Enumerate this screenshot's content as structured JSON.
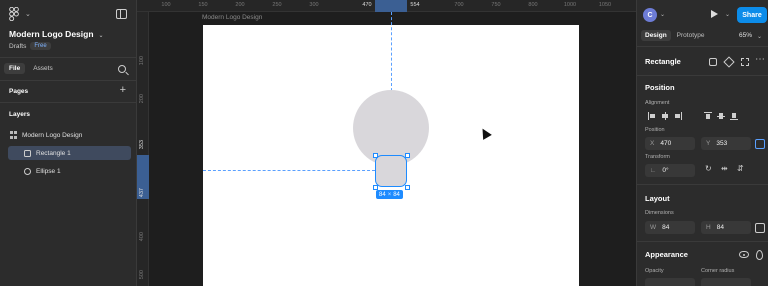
{
  "app": {
    "file_name": "Modern Logo Design",
    "drafts_label": "Drafts",
    "plan_badge": "Free"
  },
  "left_panel": {
    "tabs": [
      "File",
      "Assets"
    ],
    "pages_label": "Pages",
    "layers_label": "Layers",
    "layers": [
      {
        "name": "Modern Logo Design",
        "type": "frame",
        "selected": false
      },
      {
        "name": "Rectangle 1",
        "type": "rectangle",
        "selected": true
      },
      {
        "name": "Ellipse 1",
        "type": "ellipse",
        "selected": false
      }
    ]
  },
  "canvas": {
    "frame_label": "Modern Logo Design",
    "ruler_top": [
      "100",
      "150",
      "200",
      "250",
      "300",
      "470",
      "554",
      "700",
      "750",
      "800",
      "1000",
      "1050",
      "1100"
    ],
    "ruler_left": [
      "100",
      "200",
      "353",
      "437",
      "400",
      "500"
    ],
    "selection_width": "84",
    "selection_x_sep": "×",
    "selection_height": "84"
  },
  "right_panel": {
    "avatar_initial": "C",
    "share_label": "Share",
    "tabs": [
      "Design",
      "Prototype"
    ],
    "zoom": "65%",
    "selection_type": "Rectangle",
    "position_title": "Position",
    "alignment_label": "Alignment",
    "position_label": "Position",
    "x_key": "X",
    "x_value": "470",
    "y_key": "Y",
    "y_value": "353",
    "transform_label": "Transform",
    "rotation_value": "0°",
    "layout_title": "Layout",
    "dimensions_label": "Dimensions",
    "w_key": "W",
    "w_value": "84",
    "h_key": "H",
    "h_value": "84",
    "appearance_title": "Appearance",
    "opacity_label": "Opacity",
    "corner_radius_label": "Corner radius"
  },
  "colors": {
    "accent": "#0c8ce9",
    "selection": "#1e8bff",
    "shape_fill": "#d9d7db"
  }
}
